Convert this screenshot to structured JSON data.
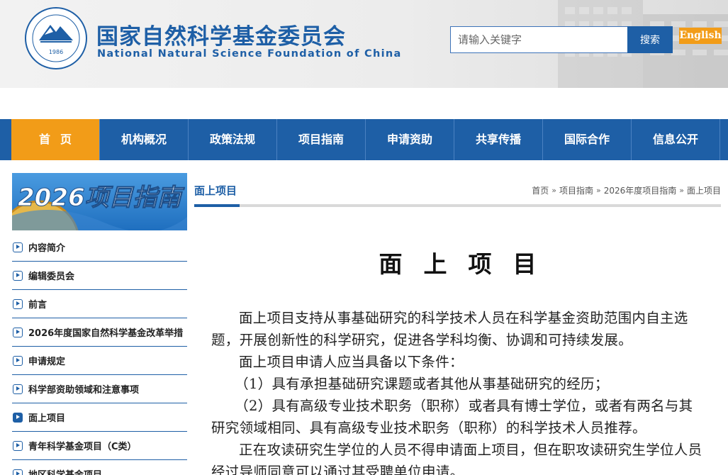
{
  "header": {
    "org_name_cn": "国家自然科学基金委员会",
    "org_name_en": "National Natural Science Foundation of China",
    "logo_year": "1986",
    "search_placeholder": "请输入关键字",
    "search_button": "搜索",
    "english_link": "English"
  },
  "nav": {
    "items": [
      {
        "label": "首页",
        "active": true
      },
      {
        "label": "机构概况"
      },
      {
        "label": "政策法规"
      },
      {
        "label": "项目指南"
      },
      {
        "label": "申请资助"
      },
      {
        "label": "共享传播"
      },
      {
        "label": "国际合作"
      },
      {
        "label": "信息公开"
      }
    ]
  },
  "sidebar": {
    "banner_text": "2026项目指南",
    "items": [
      {
        "label": "内容简介"
      },
      {
        "label": "编辑委员会"
      },
      {
        "label": "前言"
      },
      {
        "label": "2026年度国家自然科学基金改革举措"
      },
      {
        "label": "申请规定"
      },
      {
        "label": "科学部资助领域和注意事项"
      },
      {
        "label": "面上项目",
        "active": true
      },
      {
        "label": "青年科学基金项目（C类）"
      },
      {
        "label": "地区科学基金项目"
      }
    ]
  },
  "main": {
    "section_title": "面上项目",
    "breadcrumb": [
      "首页",
      "项目指南",
      "2026年度项目指南",
      "面上项目"
    ],
    "article_title": "面上项目",
    "paragraphs": [
      "面上项目支持从事基础研究的科学技术人员在科学基金资助范围内自主选题，开展创新性的科学研究，促进各学科均衡、协调和可持续发展。",
      "面上项目申请人应当具备以下条件：",
      "（1）具有承担基础研究课题或者其他从事基础研究的经历；",
      "（2）具有高级专业技术职务（职称）或者具有博士学位，或者有两名与其研究领域相同、具有高级专业技术职务（职称）的科学技术人员推荐。",
      "正在攻读研究生学位的人员不得申请面上项目，但在职攻读研究生学位人员经过导师同意可以通过其受聘单位申请。"
    ]
  },
  "colors": {
    "brand_blue": "#1e5fa6",
    "accent_orange": "#f29c18"
  }
}
